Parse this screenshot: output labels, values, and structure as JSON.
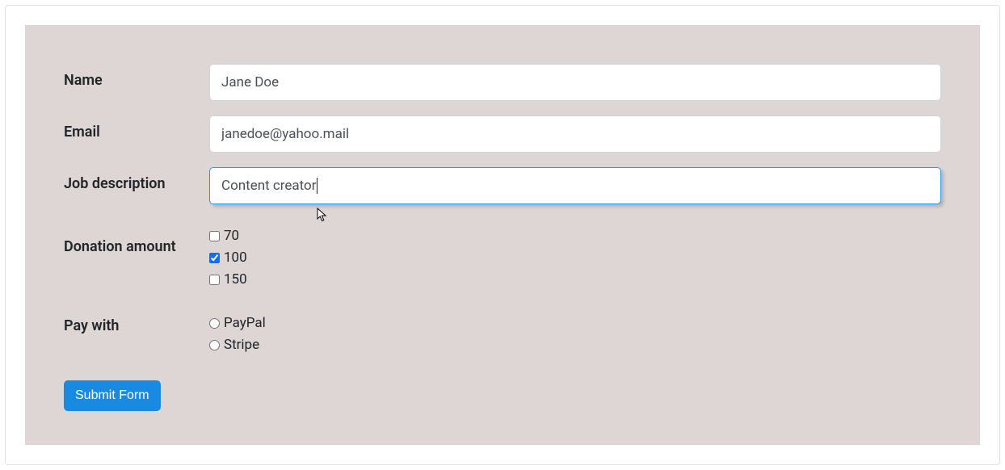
{
  "form": {
    "nameLabel": "Name",
    "nameValue": "Jane Doe",
    "emailLabel": "Email",
    "emailValue": "janedoe@yahoo.mail",
    "jobLabel": "Job description",
    "jobValue": "Content creator",
    "donationLabel": "Donation amount",
    "donationOptions": [
      {
        "label": "70",
        "checked": false
      },
      {
        "label": "100",
        "checked": true
      },
      {
        "label": "150",
        "checked": false
      }
    ],
    "payLabel": "Pay with",
    "payOptions": [
      {
        "label": "PayPal",
        "checked": false
      },
      {
        "label": "Stripe",
        "checked": false
      }
    ],
    "submitLabel": "Submit Form"
  }
}
